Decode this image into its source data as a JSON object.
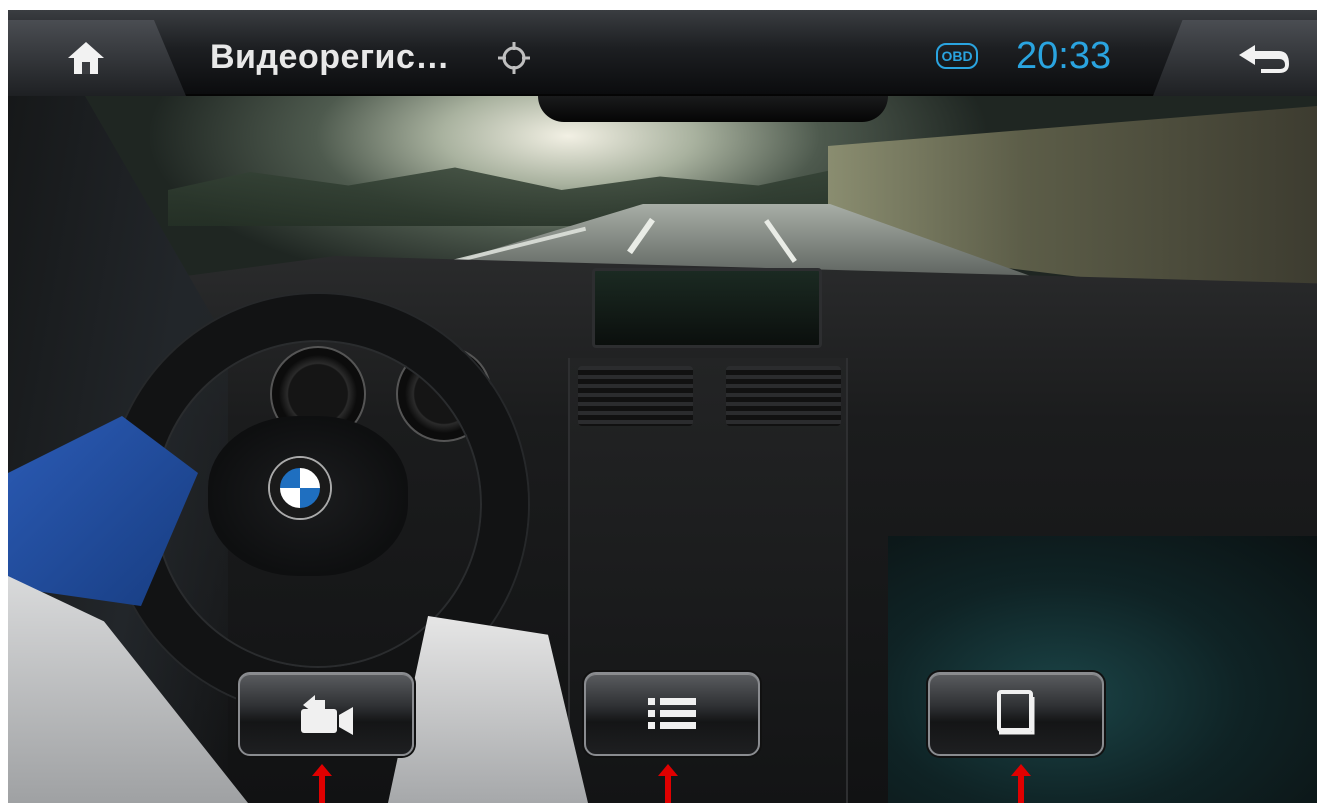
{
  "header": {
    "home_button": "home-icon",
    "title": "Видеорегис…",
    "gps_icon": "crosshair-icon",
    "obd_badge": "OBD",
    "clock": "20:33",
    "back_button": "back-arrow-icon",
    "accent_color": "#2aa4e0"
  },
  "controls": [
    {
      "icon": "camera-record-icon"
    },
    {
      "icon": "list-icon"
    },
    {
      "icon": "folder-icon"
    }
  ],
  "annotations": {
    "arrow_color": "#e00000"
  }
}
